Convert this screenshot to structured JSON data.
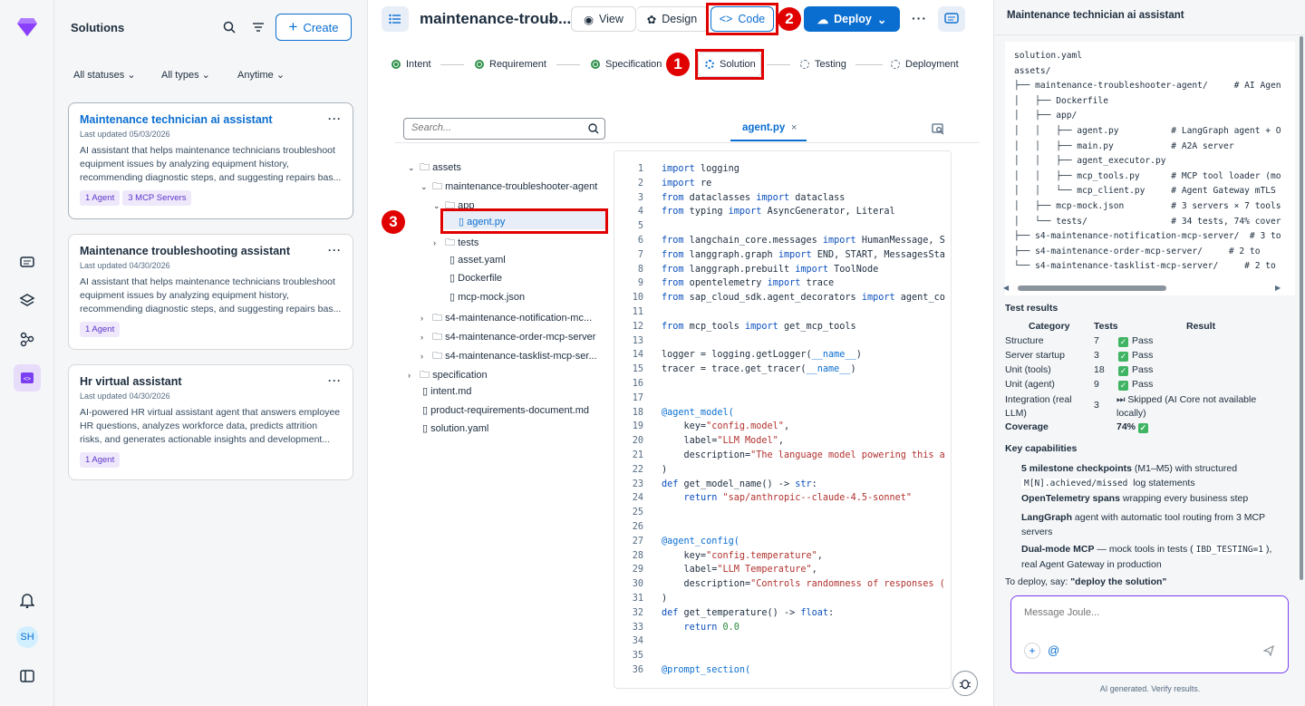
{
  "solutions_panel": {
    "title": "Solutions",
    "create_label": "Create",
    "filters": [
      "All statuses",
      "All types",
      "Anytime"
    ],
    "cards": [
      {
        "title": "Maintenance technician ai assistant",
        "updated": "Last updated  05/03/2026",
        "desc": "AI assistant that helps maintenance technicians troubleshoot equipment issues by analyzing equipment history, recommending diagnostic steps, and suggesting repairs bas...",
        "badges": [
          "1 Agent",
          "3 MCP Servers"
        ]
      },
      {
        "title": "Maintenance troubleshooting assistant",
        "updated": "Last updated  04/30/2026",
        "desc": "AI assistant that helps maintenance technicians troubleshoot equipment issues by analyzing equipment history, recommending diagnostic steps, and suggesting repairs bas...",
        "badges": [
          "1 Agent"
        ]
      },
      {
        "title": "Hr virtual assistant",
        "updated": "Last updated  04/30/2026",
        "desc": "AI-powered HR virtual assistant agent that answers employee HR questions, analyzes workforce data, predicts attrition risks, and generates actionable insights and development...",
        "badges": [
          "1 Agent"
        ]
      }
    ]
  },
  "rail": {
    "avatar": "SH"
  },
  "main": {
    "title": "maintenance-troub...",
    "view_label": "View",
    "design_label": "Design",
    "code_label": "Code",
    "deploy_label": "Deploy",
    "steps": [
      "Intent",
      "Requirement",
      "Specification",
      "Solution",
      "Testing",
      "Deployment"
    ],
    "annotations": [
      "1",
      "2",
      "3"
    ],
    "search_placeholder": "Search...",
    "tab": "agent.py",
    "tab_close": "×",
    "tree": [
      "assets",
      "maintenance-troubleshooter-agent",
      "app",
      "agent.py",
      "tests",
      "asset.yaml",
      "Dockerfile",
      "mcp-mock.json",
      "s4-maintenance-notification-mc...",
      "s4-maintenance-order-mcp-server",
      "s4-maintenance-tasklist-mcp-ser...",
      "specification",
      "intent.md",
      "product-requirements-document.md",
      "solution.yaml"
    ],
    "code": [
      [
        "1",
        "import logging"
      ],
      [
        "2",
        "import re"
      ],
      [
        "3",
        "from dataclasses import dataclass"
      ],
      [
        "4",
        "from typing import AsyncGenerator, Literal"
      ],
      [
        "5",
        ""
      ],
      [
        "6",
        "from langchain_core.messages import HumanMessage, S"
      ],
      [
        "7",
        "from langgraph.graph import END, START, MessagesSta"
      ],
      [
        "8",
        "from langgraph.prebuilt import ToolNode"
      ],
      [
        "9",
        "from opentelemetry import trace"
      ],
      [
        "10",
        "from sap_cloud_sdk.agent_decorators import agent_co"
      ],
      [
        "11",
        ""
      ],
      [
        "12",
        "from mcp_tools import get_mcp_tools"
      ],
      [
        "13",
        ""
      ],
      [
        "14",
        "logger = logging.getLogger(__name__)"
      ],
      [
        "15",
        "tracer = trace.get_tracer(__name__)"
      ],
      [
        "16",
        ""
      ],
      [
        "17",
        ""
      ],
      [
        "18",
        "@agent_model("
      ],
      [
        "19",
        "    key=\"config.model\","
      ],
      [
        "20",
        "    label=\"LLM Model\","
      ],
      [
        "21",
        "    description=\"The language model powering this a"
      ],
      [
        "22",
        ")"
      ],
      [
        "23",
        "def get_model_name() -> str:"
      ],
      [
        "24",
        "    return \"sap/anthropic--claude-4.5-sonnet\""
      ],
      [
        "25",
        ""
      ],
      [
        "26",
        ""
      ],
      [
        "27",
        "@agent_config("
      ],
      [
        "28",
        "    key=\"config.temperature\","
      ],
      [
        "29",
        "    label=\"LLM Temperature\","
      ],
      [
        "30",
        "    description=\"Controls randomness of responses ("
      ],
      [
        "31",
        ")"
      ],
      [
        "32",
        "def get_temperature() -> float:"
      ],
      [
        "33",
        "    return 0.0"
      ],
      [
        "34",
        ""
      ],
      [
        "35",
        ""
      ],
      [
        "36",
        "@prompt_section("
      ]
    ]
  },
  "right": {
    "title": "Maintenance technician ai assistant",
    "yaml": [
      "solution.yaml",
      "assets/",
      "├── maintenance-troubleshooter-agent/     # AI Agen",
      "│   ├── Dockerfile",
      "│   ├── app/",
      "│   │   ├── agent.py          # LangGraph agent + O",
      "│   │   ├── main.py           # A2A server",
      "│   │   ├── agent_executor.py",
      "│   │   ├── mcp_tools.py      # MCP tool loader (mo",
      "│   │   └── mcp_client.py     # Agent Gateway mTLS",
      "│   ├── mcp-mock.json         # 3 servers × 7 tools",
      "│   └── tests/                # 34 tests, 74% cover",
      "├── s4-maintenance-notification-mcp-server/  # 3 to",
      "├── s4-maintenance-order-mcp-server/     # 2 to",
      "└── s4-maintenance-tasklist-mcp-server/     # 2 to"
    ],
    "test_title": "Test results",
    "headers": [
      "Category",
      "Tests",
      "Result"
    ],
    "rows": [
      [
        "Structure",
        "7",
        "Pass"
      ],
      [
        "Server startup",
        "3",
        "Pass"
      ],
      [
        "Unit (tools)",
        "18",
        "Pass"
      ],
      [
        "Unit (agent)",
        "9",
        "Pass"
      ]
    ],
    "integration": {
      "cat1": "Integration (real",
      "cat2": "LLM)",
      "tests": "3",
      "res1": "⏭ Skipped (AI Core not available",
      "res2": "locally)"
    },
    "coverage": {
      "label": "Coverage",
      "value": "74%"
    },
    "cap_title": "Key capabilities",
    "caps": {
      "c1b": "5 milestone checkpoints",
      "c1": " (M1–M5) with structured",
      "c1m": "M[N].achieved/missed",
      "c1e": " log statements",
      "c2b": "OpenTelemetry spans",
      "c2": " wrapping every business step",
      "c3b": "LangGraph",
      "c3": " agent with automatic tool routing from 3 MCP",
      "c3e": "servers",
      "c4b": "Dual-mode MCP",
      "c4": " — mock tools in tests (",
      "c4m": "IBD_TESTING=1",
      "c4e": "),",
      "c4f": "real Agent Gateway in production"
    },
    "deploy_pre": "To deploy, say: ",
    "deploy_b": "\"deploy the solution\"",
    "msg_placeholder": "Message Joule...",
    "footer": "AI generated. Verify results."
  }
}
